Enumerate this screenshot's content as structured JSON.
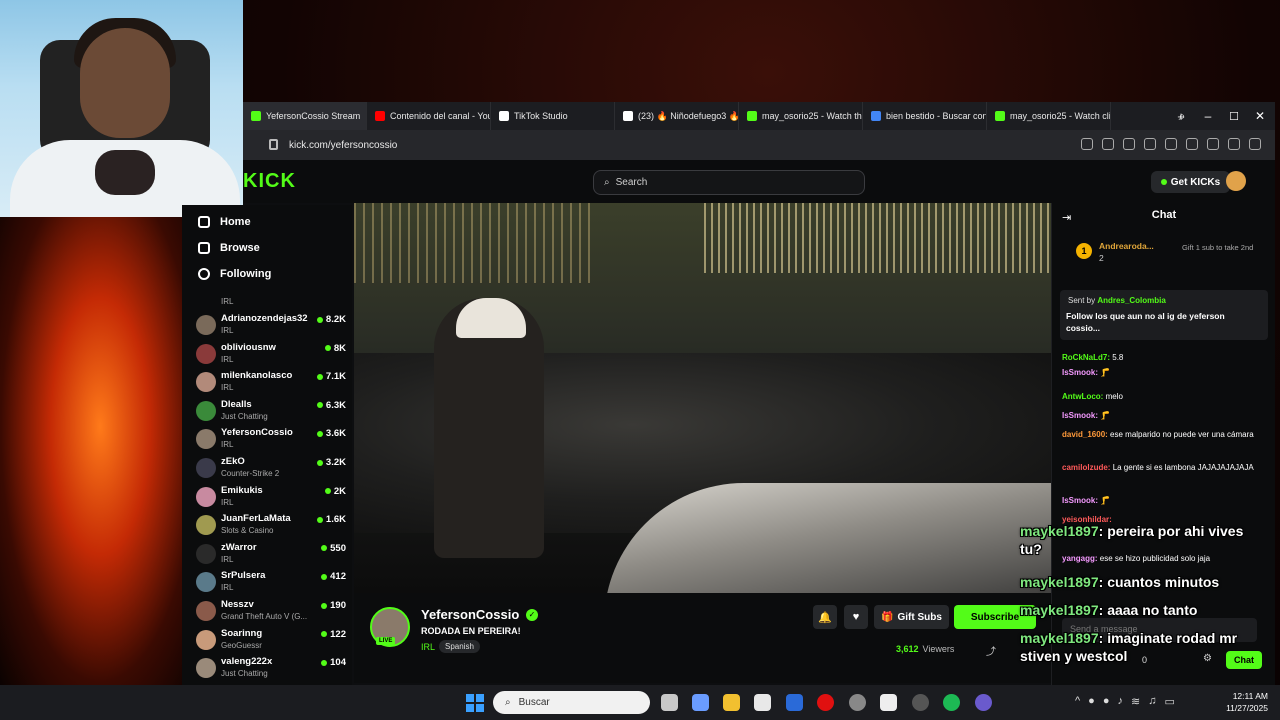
{
  "browser": {
    "tabs": [
      {
        "label": "YefersonCossio Stream",
        "color": "#53fc18"
      },
      {
        "label": "Contenido del canal - You",
        "color": "#ff0000"
      },
      {
        "label": "TikTok Studio",
        "color": "#ffffff"
      },
      {
        "label": "(23) 🔥 Niñodefuego3 🔥",
        "color": "#ffffff"
      },
      {
        "label": "may_osorio25 - Watch the",
        "color": "#53fc18"
      },
      {
        "label": "bien bestido - Buscar con",
        "color": "#4285f4"
      },
      {
        "label": "may_osorio25 - Watch cli",
        "color": "#53fc18"
      }
    ],
    "url": "kick.com/yefersoncossio"
  },
  "header": {
    "logo": "KICK",
    "search_placeholder": "Search",
    "get_kicks": "Get KICKs"
  },
  "sidebar": {
    "nav": [
      {
        "label": "Home",
        "icon": "home-icon"
      },
      {
        "label": "Browse",
        "icon": "browse-icon"
      },
      {
        "label": "Following",
        "icon": "heart-icon"
      }
    ],
    "top_category": "IRL",
    "channels": [
      {
        "name": "Adrianozendejas32",
        "category": "IRL",
        "viewers": "8.2K",
        "color": "#7a6a5a"
      },
      {
        "name": "obliviousnw",
        "category": "IRL",
        "viewers": "8K",
        "color": "#8a3a3a"
      },
      {
        "name": "milenkanolasco",
        "category": "IRL",
        "viewers": "7.1K",
        "color": "#b28a7a"
      },
      {
        "name": "Dlealls",
        "category": "Just Chatting",
        "viewers": "6.3K",
        "color": "#3a8a3a"
      },
      {
        "name": "YefersonCossio",
        "category": "IRL",
        "viewers": "3.6K",
        "color": "#8a7a6a"
      },
      {
        "name": "zEkO",
        "category": "Counter-Strike 2",
        "viewers": "3.2K",
        "color": "#3a3a4a"
      },
      {
        "name": "Emikukis",
        "category": "IRL",
        "viewers": "2K",
        "color": "#c88aa0"
      },
      {
        "name": "JuanFerLaMata",
        "category": "Slots & Casino",
        "viewers": "1.6K",
        "color": "#a09a50"
      },
      {
        "name": "zWarror",
        "category": "IRL",
        "viewers": "550",
        "color": "#2a2a2a"
      },
      {
        "name": "SrPulsera",
        "category": "IRL",
        "viewers": "412",
        "color": "#5a7a8a"
      },
      {
        "name": "Nesszv",
        "category": "Grand Theft Auto V (G...",
        "viewers": "190",
        "color": "#8a5a4a"
      },
      {
        "name": "Soarinng",
        "category": "GeoGuessr",
        "viewers": "122",
        "color": "#c89a7a"
      },
      {
        "name": "valeng222x",
        "category": "Just Chatting",
        "viewers": "104",
        "color": "#9a8a7a"
      }
    ]
  },
  "stream": {
    "channel": "YefersonCossio",
    "live_badge": "LIVE",
    "title": "RODADA EN PEREIRA!",
    "category": "IRL",
    "language": "Spanish",
    "gift_subs": "Gift Subs",
    "subscribe": "Subscribe",
    "viewers": "3,612",
    "viewers_label": "Viewers"
  },
  "chat": {
    "title": "Chat",
    "gifter": {
      "rank": "1",
      "name": "Andrearoda...",
      "count": "2",
      "cta": "Gift 1 sub to take 2nd"
    },
    "pinned": {
      "sent_by": "Sent by",
      "author": "Andres_Colombia",
      "text": "Follow los que aun no al ig de yeferson cossio..."
    },
    "messages": [
      {
        "user": "RoCkNaLd7:",
        "text": "5.8",
        "color": "#53fc18"
      },
      {
        "user": "IsSmook:",
        "text": "🦵",
        "color": "#f59aff"
      },
      {
        "user": "AntwLoco:",
        "text": "melo",
        "color": "#53fc18"
      },
      {
        "user": "IsSmook:",
        "text": "🦵",
        "color": "#f59aff"
      },
      {
        "user": "david_1600:",
        "text": "ese malparido no puede ver una cámara",
        "color": "#ff9a3a"
      },
      {
        "user": "camilolzude:",
        "text": "La gente si es lambona JAJAJAJAJAJA",
        "color": "#ff5a5a"
      },
      {
        "user": "IsSmook:",
        "text": "🦵",
        "color": "#f59aff"
      },
      {
        "user": "yeisonhildar:",
        "text": "",
        "color": "#ff5a5a"
      },
      {
        "user": "yangagg:",
        "text": "ese se hizo publicidad solo jaja",
        "color": "#f59aff"
      }
    ],
    "input_placeholder": "Send a message",
    "send": "Chat",
    "kicks_count": "0"
  },
  "overlay": [
    {
      "user": "maykel1897",
      "text": ": pereira por ahi vives tu?"
    },
    {
      "user": "maykel1897",
      "text": ": cuantos minutos"
    },
    {
      "user": "maykel1897",
      "text": ": aaaa no tanto"
    },
    {
      "user": "maykel1897",
      "text": ": imaginate rodad mr stiven y westcol"
    }
  ],
  "taskbar": {
    "search": "Buscar",
    "time": "12:11 AM",
    "date": "11/27/2025"
  }
}
